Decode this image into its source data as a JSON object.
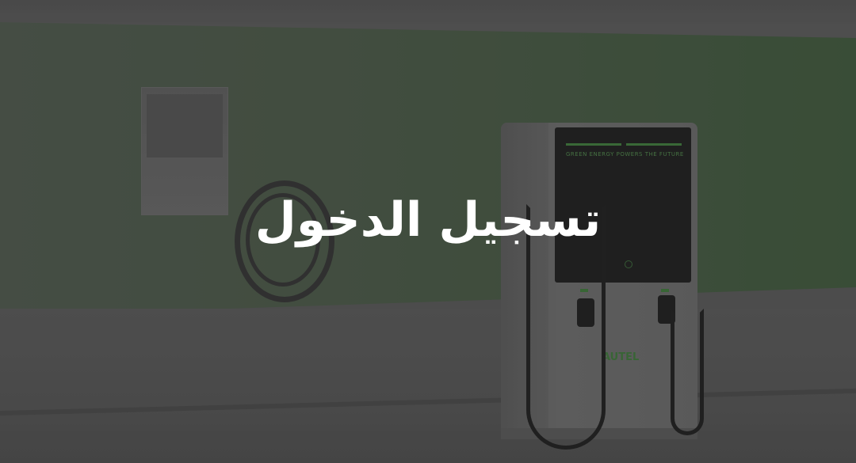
{
  "hero": {
    "title": "تسجيل الدخول",
    "charger_tagline": "GREEN ENERGY POWERS THE FUTURE",
    "charger_brand": "AUTEL"
  },
  "colors": {
    "overlay": "#3a3a3a",
    "accent_green": "#3e7a3a",
    "title_text": "#ffffff"
  }
}
